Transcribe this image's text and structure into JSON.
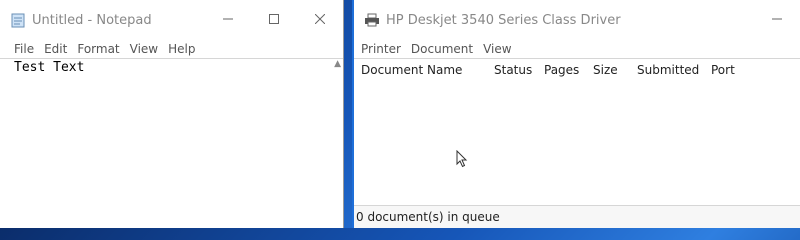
{
  "notepad": {
    "title": "Untitled - Notepad",
    "menu": [
      "File",
      "Edit",
      "Format",
      "View",
      "Help"
    ],
    "content": "Test Text",
    "icons": {
      "app": "notepad-icon",
      "minimize": "minimize-icon",
      "maximize": "maximize-icon",
      "close": "close-icon"
    }
  },
  "printer": {
    "title": "HP Deskjet 3540 Series Class Driver",
    "menu": [
      "Printer",
      "Document",
      "View"
    ],
    "columns": [
      "Document Name",
      "Status",
      "Pages",
      "Size",
      "Submitted",
      "Port"
    ],
    "jobs": [],
    "status": "0 document(s) in queue",
    "icons": {
      "app": "printer-icon",
      "minimize": "minimize-icon",
      "pointer": "mouse-pointer-icon"
    }
  },
  "colors": {
    "desktop": "#1656b8",
    "window_border_active": "#1e6fd9",
    "window_bg": "#ffffff"
  }
}
